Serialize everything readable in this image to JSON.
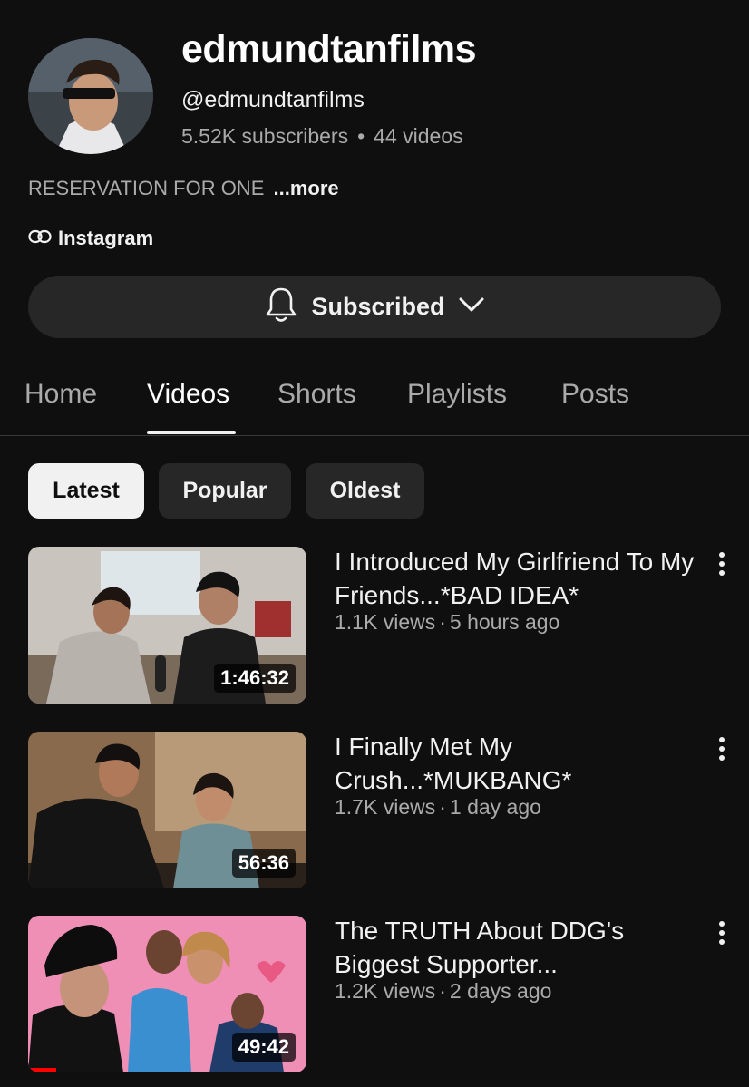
{
  "channel": {
    "name": "edmundtanfilms",
    "handle": "@edmundtanfilms",
    "subscribers": "5.52K subscribers",
    "videos_count": "44 videos",
    "dot": "•",
    "description": "RESERVATION FOR ONE",
    "more_label": "...more",
    "link_label": "Instagram",
    "subscribe_label": "Subscribed"
  },
  "tabs": [
    {
      "label": "Home"
    },
    {
      "label": "Videos",
      "active": true
    },
    {
      "label": "Shorts"
    },
    {
      "label": "Playlists"
    },
    {
      "label": "Posts"
    }
  ],
  "chips": [
    {
      "label": "Latest",
      "active": true
    },
    {
      "label": "Popular"
    },
    {
      "label": "Oldest"
    }
  ],
  "videos": [
    {
      "title": "I Introduced My Girlfriend To My Friends...*BAD IDEA*",
      "views": "1.1K views",
      "age": "5 hours ago",
      "duration": "1:46:32"
    },
    {
      "title": "I Finally Met My Crush...*MUKBANG*",
      "views": "1.7K views",
      "age": "1 day ago",
      "duration": "56:36"
    },
    {
      "title": "The TRUTH About DDG's Biggest Supporter...",
      "views": "1.2K views",
      "age": "2 days ago",
      "duration": "49:42",
      "watched_fraction": 0.1
    }
  ],
  "meta_separator": "·",
  "icons": {
    "bell": "bell-icon",
    "chevron": "chevron-down-icon",
    "link": "link-icon",
    "more": "more-vertical-icon"
  },
  "colors": {
    "background": "#0f0f0f",
    "chip_active": "#f1f1f1",
    "chip": "#272727",
    "progress": "#ff0000"
  }
}
